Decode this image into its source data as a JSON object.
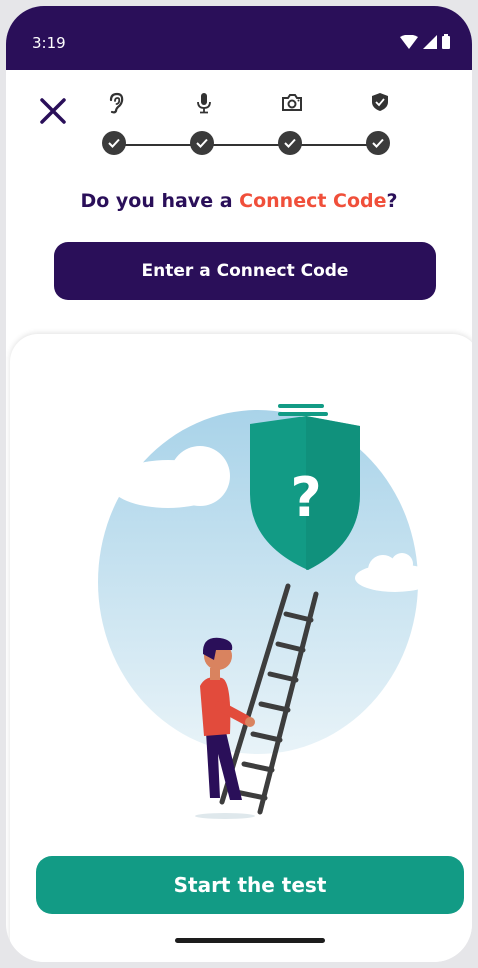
{
  "status_bar": {
    "time": "3:19",
    "icons": [
      "wifi-icon",
      "cell-signal-icon",
      "battery-icon"
    ]
  },
  "header": {
    "close_icon": "close-icon",
    "steps": [
      {
        "icon": "ear-icon",
        "completed": true
      },
      {
        "icon": "microphone-icon",
        "completed": true
      },
      {
        "icon": "camera-icon",
        "completed": true
      },
      {
        "icon": "shield-icon",
        "completed": true
      }
    ]
  },
  "main": {
    "question_prefix": "Do you have a ",
    "question_accent": "Connect Code",
    "question_suffix": "?",
    "connect_button_label": "Enter a Connect Code",
    "illustration": {
      "shield_symbol": "?",
      "description_icon": "person-climbing-ladder-to-shield-illustration"
    },
    "start_button_label": "Start the test"
  },
  "colors": {
    "brand_purple": "#2a0f59",
    "accent_red": "#f04f3a",
    "teal": "#129b85",
    "sky_blue": "#bfe0ef"
  }
}
